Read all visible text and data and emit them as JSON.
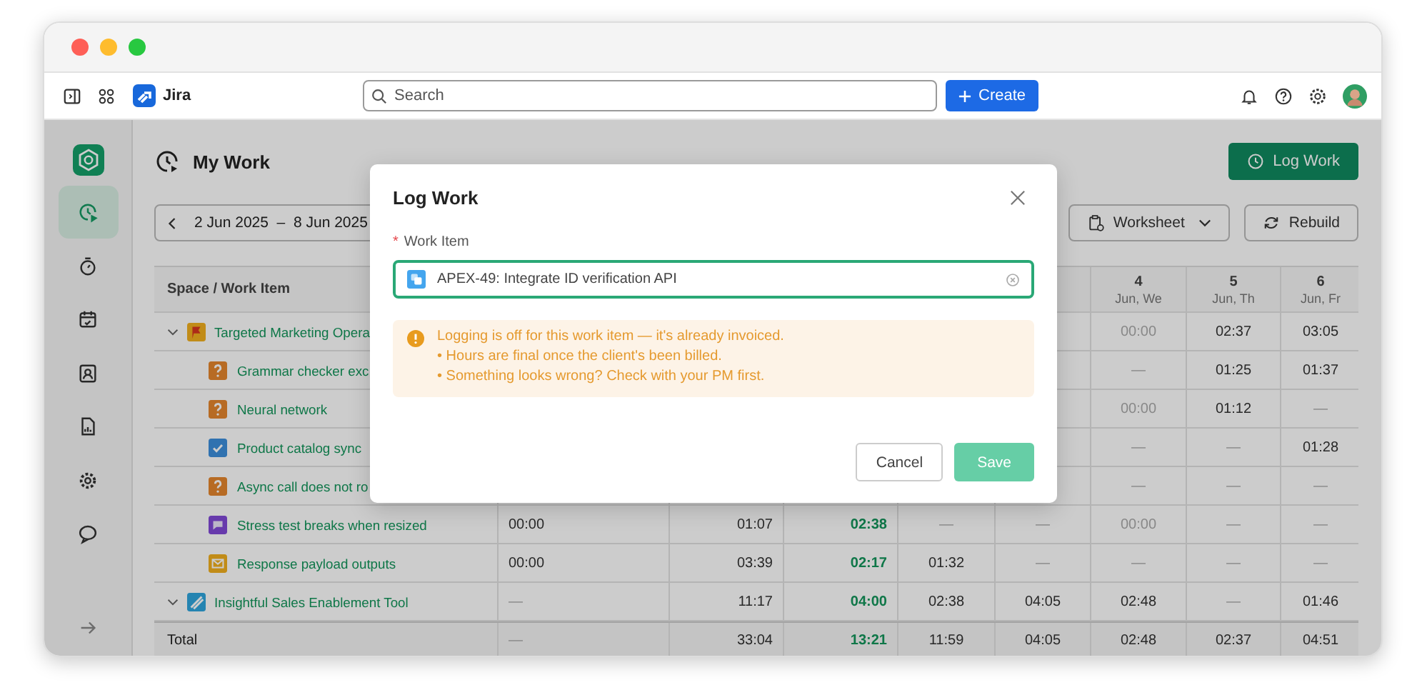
{
  "topbar": {
    "app_name": "Jira",
    "search": {
      "placeholder": "Search"
    },
    "create_button": "Create"
  },
  "sidebar": {
    "items": [
      {
        "kind": "clock",
        "selected": true
      },
      {
        "kind": "stopwatch",
        "selected": false
      },
      {
        "kind": "calendar",
        "selected": false
      },
      {
        "kind": "contact",
        "selected": false
      },
      {
        "kind": "report",
        "selected": false
      },
      {
        "kind": "gear",
        "selected": false
      },
      {
        "kind": "chat",
        "selected": false
      }
    ]
  },
  "page": {
    "title": "My Work",
    "log_work_button": "Log Work",
    "date_range": "2 Jun 2025  –  8 Jun 2025",
    "worksheet_button": "Worksheet",
    "rebuild_button": "Rebuild"
  },
  "table": {
    "tree_header": "Space / Work Item",
    "columns": [
      "",
      "",
      "",
      "",
      "",
      {
        "day": "4",
        "date": "Jun, We"
      },
      {
        "day": "5",
        "date": "Jun, Th"
      },
      {
        "day": "6",
        "date": "Jun, Fr"
      }
    ],
    "rows": [
      {
        "title": "Targeted Marketing Opera",
        "kind": "flag",
        "expanded": true,
        "cells": [
          "",
          "",
          "",
          "",
          "",
          {
            "text": "00:00",
            "muted": true,
            "accent": false
          },
          {
            "text": "02:37",
            "muted": false,
            "accent": false
          },
          {
            "text": "03:05",
            "muted": false,
            "accent": false
          }
        ],
        "children": [
          {
            "title": "Grammar checker exc",
            "kind": "question",
            "cells": [
              "",
              "",
              "",
              "",
              "",
              {
                "text": "—",
                "muted": true,
                "accent": false
              },
              {
                "text": "01:25",
                "muted": false,
                "accent": false
              },
              {
                "text": "01:37",
                "muted": false,
                "accent": false
              }
            ]
          },
          {
            "title": "Neural network",
            "kind": "question",
            "cells": [
              "",
              "",
              "",
              "",
              "",
              {
                "text": "00:00",
                "muted": true,
                "accent": false
              },
              {
                "text": "01:12",
                "muted": false,
                "accent": false
              },
              {
                "text": "—",
                "muted": true,
                "accent": false
              }
            ]
          },
          {
            "title": "Product catalog sync",
            "kind": "check",
            "cells": [
              "",
              "",
              "",
              "",
              "",
              {
                "text": "—",
                "muted": true,
                "accent": false
              },
              {
                "text": "—",
                "muted": true,
                "accent": false
              },
              {
                "text": "01:28",
                "muted": false,
                "accent": false
              }
            ]
          },
          {
            "title": "Async call does not ro",
            "kind": "question",
            "cells": [
              "",
              "",
              "",
              "",
              "",
              {
                "text": "—",
                "muted": true,
                "accent": false
              },
              {
                "text": "—",
                "muted": true,
                "accent": false
              },
              {
                "text": "—",
                "muted": true,
                "accent": false
              }
            ]
          },
          {
            "title": "Stress test breaks when resized",
            "kind": "note",
            "cells": [
              {
                "text": "00:00",
                "muted": false,
                "accent": false
              },
              {
                "text": "01:07",
                "muted": false,
                "accent": false
              },
              {
                "text": "02:38",
                "muted": false,
                "accent": true
              },
              {
                "text": "—",
                "muted": true,
                "accent": false
              },
              {
                "text": "—",
                "muted": true,
                "accent": false
              },
              {
                "text": "00:00",
                "muted": true,
                "accent": false
              },
              {
                "text": "—",
                "muted": true,
                "accent": false
              },
              {
                "text": "—",
                "muted": true,
                "accent": false
              }
            ]
          },
          {
            "title": "Response payload outputs",
            "kind": "mail",
            "cells": [
              {
                "text": "00:00",
                "muted": false,
                "accent": false
              },
              {
                "text": "03:39",
                "muted": false,
                "accent": false
              },
              {
                "text": "02:17",
                "muted": false,
                "accent": true
              },
              {
                "text": "01:32",
                "muted": false,
                "accent": false
              },
              {
                "text": "—",
                "muted": true,
                "accent": false
              },
              {
                "text": "—",
                "muted": true,
                "accent": false
              },
              {
                "text": "—",
                "muted": true,
                "accent": false
              },
              {
                "text": "—",
                "muted": true,
                "accent": false
              }
            ]
          }
        ]
      },
      {
        "title": "Insightful Sales Enablement Tool",
        "kind": "stripe",
        "expanded": true,
        "cells": [
          {
            "text": "—",
            "muted": true,
            "accent": false
          },
          {
            "text": "11:17",
            "muted": false,
            "accent": false
          },
          {
            "text": "04:00",
            "muted": false,
            "accent": true
          },
          {
            "text": "02:38",
            "muted": false,
            "accent": false
          },
          {
            "text": "04:05",
            "muted": false,
            "accent": false
          },
          {
            "text": "02:48",
            "muted": false,
            "accent": false
          },
          {
            "text": "—",
            "muted": true,
            "accent": false
          },
          {
            "text": "01:46",
            "muted": false,
            "accent": false
          }
        ]
      }
    ],
    "total": {
      "label": "Total",
      "cells": [
        {
          "text": "—",
          "muted": true,
          "accent": false
        },
        {
          "text": "33:04",
          "muted": false,
          "accent": false
        },
        {
          "text": "13:21",
          "muted": false,
          "accent": true
        },
        {
          "text": "11:59",
          "muted": false,
          "accent": false
        },
        {
          "text": "04:05",
          "muted": false,
          "accent": false
        },
        {
          "text": "02:48",
          "muted": false,
          "accent": false
        },
        {
          "text": "02:37",
          "muted": false,
          "accent": false
        },
        {
          "text": "04:51",
          "muted": false,
          "accent": false
        }
      ]
    }
  },
  "dialog": {
    "title": "Log Work",
    "field": {
      "required_mark": "*",
      "label": "Work Item",
      "value": "APEX-49: Integrate ID verification API"
    },
    "alert": {
      "message": "Logging is off for this work item — it's already invoiced.",
      "points": [
        "• Hours are final once the client's been billed.",
        "• Something looks wrong? Check with your PM first."
      ]
    },
    "buttons": [
      {
        "label": "Cancel",
        "kind": "secondary",
        "disabled": false
      },
      {
        "label": "Save",
        "kind": "primary",
        "disabled": true
      }
    ]
  }
}
